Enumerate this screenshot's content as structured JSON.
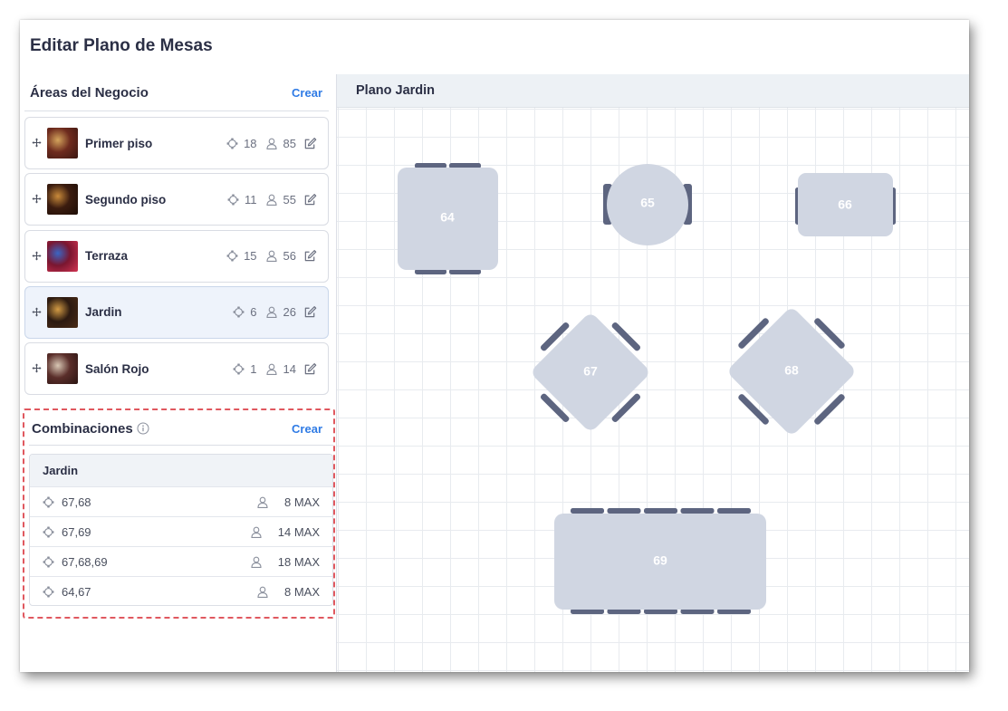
{
  "page": {
    "title": "Editar Plano de Mesas"
  },
  "areas": {
    "title": "Áreas del Negocio",
    "create_label": "Crear",
    "items": [
      {
        "name": "Primer piso",
        "tables": "18",
        "capacity": "85",
        "selected": false
      },
      {
        "name": "Segundo piso",
        "tables": "11",
        "capacity": "55",
        "selected": false
      },
      {
        "name": "Terraza",
        "tables": "15",
        "capacity": "56",
        "selected": false
      },
      {
        "name": "Jardin",
        "tables": "6",
        "capacity": "26",
        "selected": true
      },
      {
        "name": "Salón Rojo",
        "tables": "1",
        "capacity": "14",
        "selected": false
      }
    ]
  },
  "combinations": {
    "title": "Combinaciones",
    "create_label": "Crear",
    "group_name": "Jardin",
    "rows": [
      {
        "tables": "67,68",
        "capacity": "8 MAX"
      },
      {
        "tables": "67,69",
        "capacity": "14 MAX"
      },
      {
        "tables": "67,68,69",
        "capacity": "18 MAX"
      },
      {
        "tables": "64,67",
        "capacity": "8 MAX"
      }
    ]
  },
  "plan": {
    "title": "Plano Jardin",
    "tables": [
      {
        "label": "64",
        "shape": "square"
      },
      {
        "label": "65",
        "shape": "round"
      },
      {
        "label": "66",
        "shape": "rect-small"
      },
      {
        "label": "67",
        "shape": "diamond"
      },
      {
        "label": "68",
        "shape": "diamond"
      },
      {
        "label": "69",
        "shape": "long-rect"
      }
    ]
  },
  "colors": {
    "accent": "#2f7be5",
    "highlight_border": "#e0585f",
    "table_fill": "#d0d6e2",
    "chair_fill": "#5d6580",
    "selected_bg": "#eef3fb"
  }
}
